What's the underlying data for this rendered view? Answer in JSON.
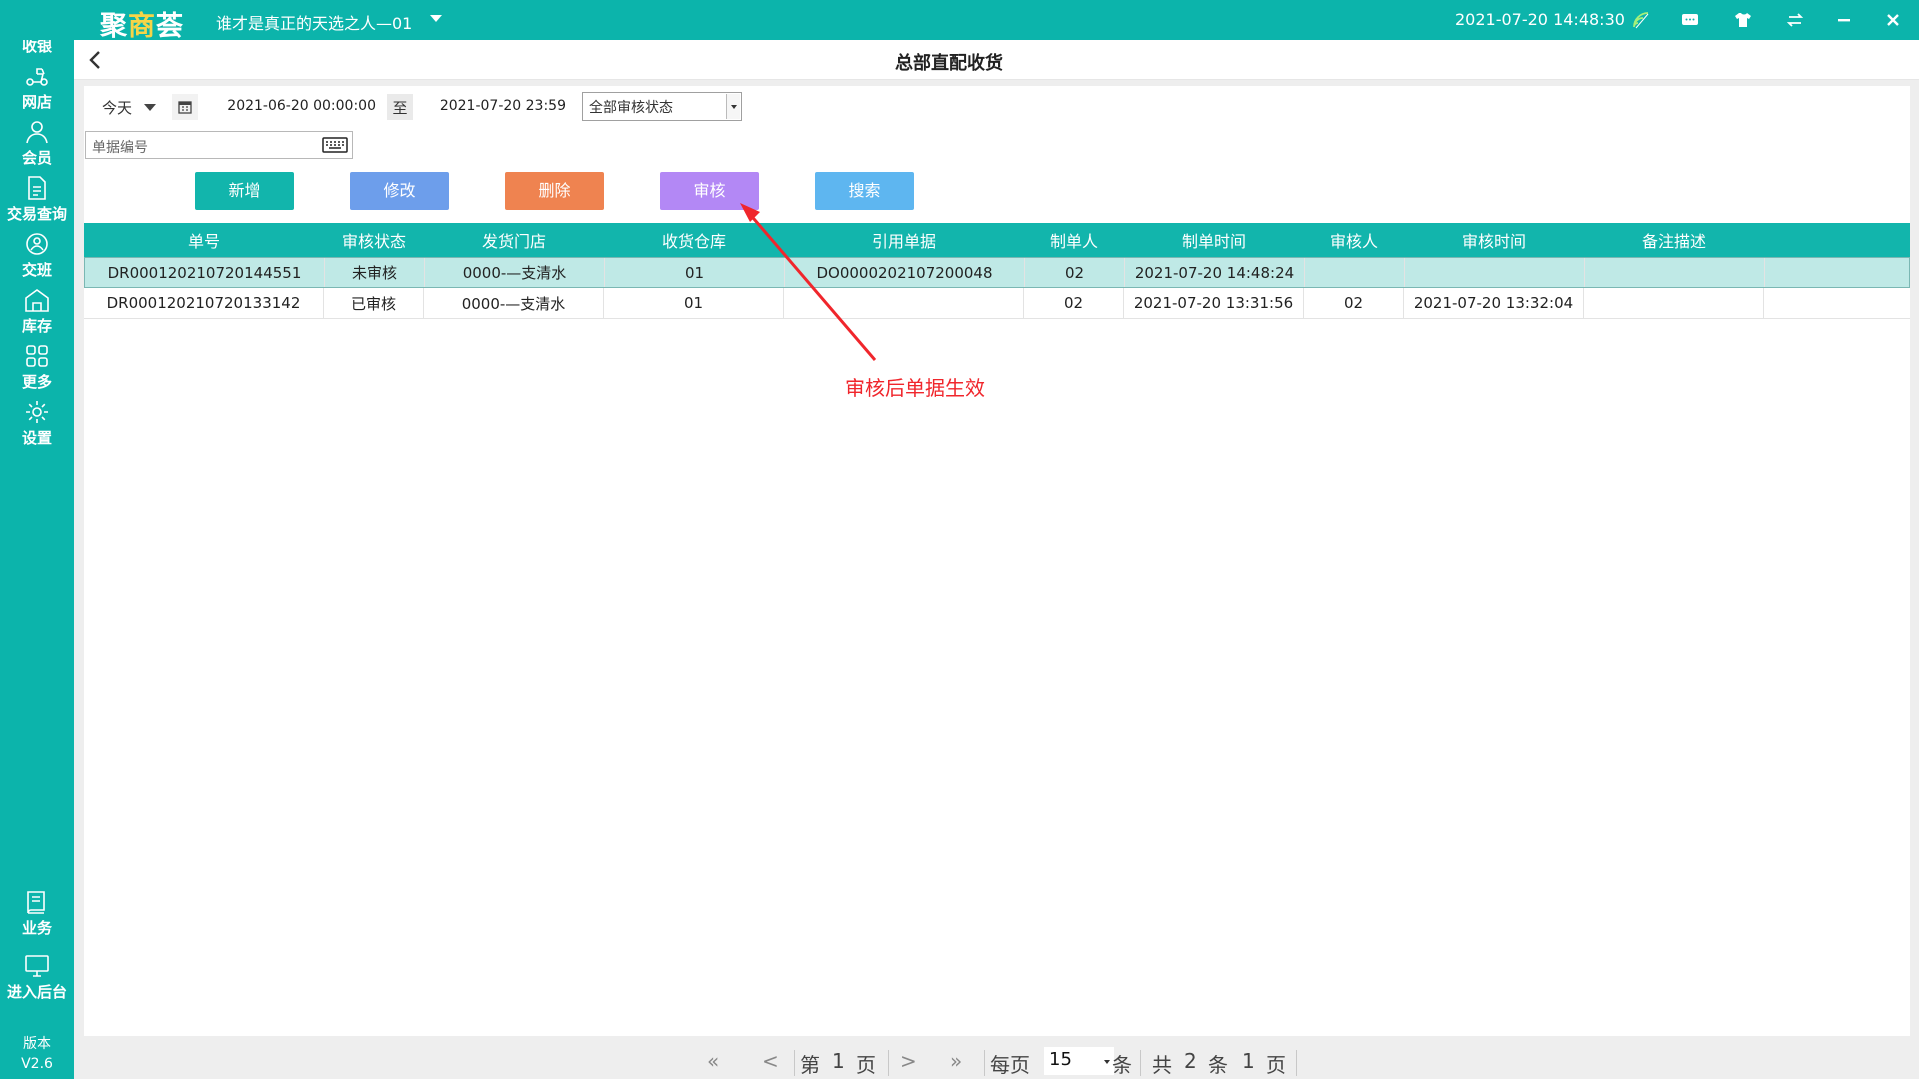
{
  "app": {
    "logo_prefix": "聚",
    "logo_highlight": "商",
    "logo_suffix": "荟",
    "store_name": "谁才是真正的天选之人—01",
    "datetime": "2021-07-20 14:48:30"
  },
  "sidebar": {
    "items": [
      {
        "label": "收银",
        "icon": "cashier-icon"
      },
      {
        "label": "网店",
        "icon": "scooter-icon"
      },
      {
        "label": "会员",
        "icon": "member-icon"
      },
      {
        "label": "交易查询",
        "icon": "document-icon"
      },
      {
        "label": "交班",
        "icon": "shift-icon"
      },
      {
        "label": "库存",
        "icon": "warehouse-icon"
      },
      {
        "label": "更多",
        "icon": "grid-icon"
      },
      {
        "label": "设置",
        "icon": "gear-icon"
      },
      {
        "label": "业务",
        "icon": "book-icon"
      },
      {
        "label": "进入后台",
        "icon": "monitor-icon"
      }
    ],
    "version_label": "版本",
    "version_value": "V2.6"
  },
  "page": {
    "title": "总部直配收货"
  },
  "filters": {
    "period": "今天",
    "date_start": "2021-06-20 00:00:00",
    "to_label": "至",
    "date_end": "2021-07-20 23:59",
    "status": "全部审核状态",
    "docno_placeholder": "单据编号"
  },
  "actions": {
    "add": "新增",
    "edit": "修改",
    "delete": "删除",
    "audit": "审核",
    "search": "搜索"
  },
  "colors": {
    "brand": "#0cb4ab",
    "add": "#12b5ac",
    "edit": "#6d9eeb",
    "delete": "#ef8350",
    "audit": "#b388f5",
    "search": "#5eb6f0",
    "annotation": "#f0262c"
  },
  "table": {
    "headers": [
      "单号",
      "审核状态",
      "发货门店",
      "收货仓库",
      "引用单据",
      "制单人",
      "制单时间",
      "审核人",
      "审核时间",
      "备注描述"
    ],
    "rows": [
      [
        "DR000120210720144551",
        "未审核",
        "0000-—支清水",
        "01",
        "DO0000202107200048",
        "02",
        "2021-07-20 14:48:24",
        "",
        "",
        ""
      ],
      [
        "DR000120210720133142",
        "已审核",
        "0000-—支清水",
        "01",
        "",
        "02",
        "2021-07-20 13:31:56",
        "02",
        "2021-07-20 13:32:04",
        ""
      ]
    ]
  },
  "annotation": {
    "text": "审核后单据生效"
  },
  "pager": {
    "first": "«",
    "prev": "<",
    "page_prefix": "第",
    "page_num": "1",
    "page_suffix": "页",
    "next": ">",
    "last": "»",
    "per_page_label": "每页",
    "per_page_value": "15",
    "per_page_unit": "条",
    "total_prefix": "共",
    "total_count": "2",
    "total_unit": "条",
    "total_pages": "1",
    "total_pages_unit": "页"
  }
}
